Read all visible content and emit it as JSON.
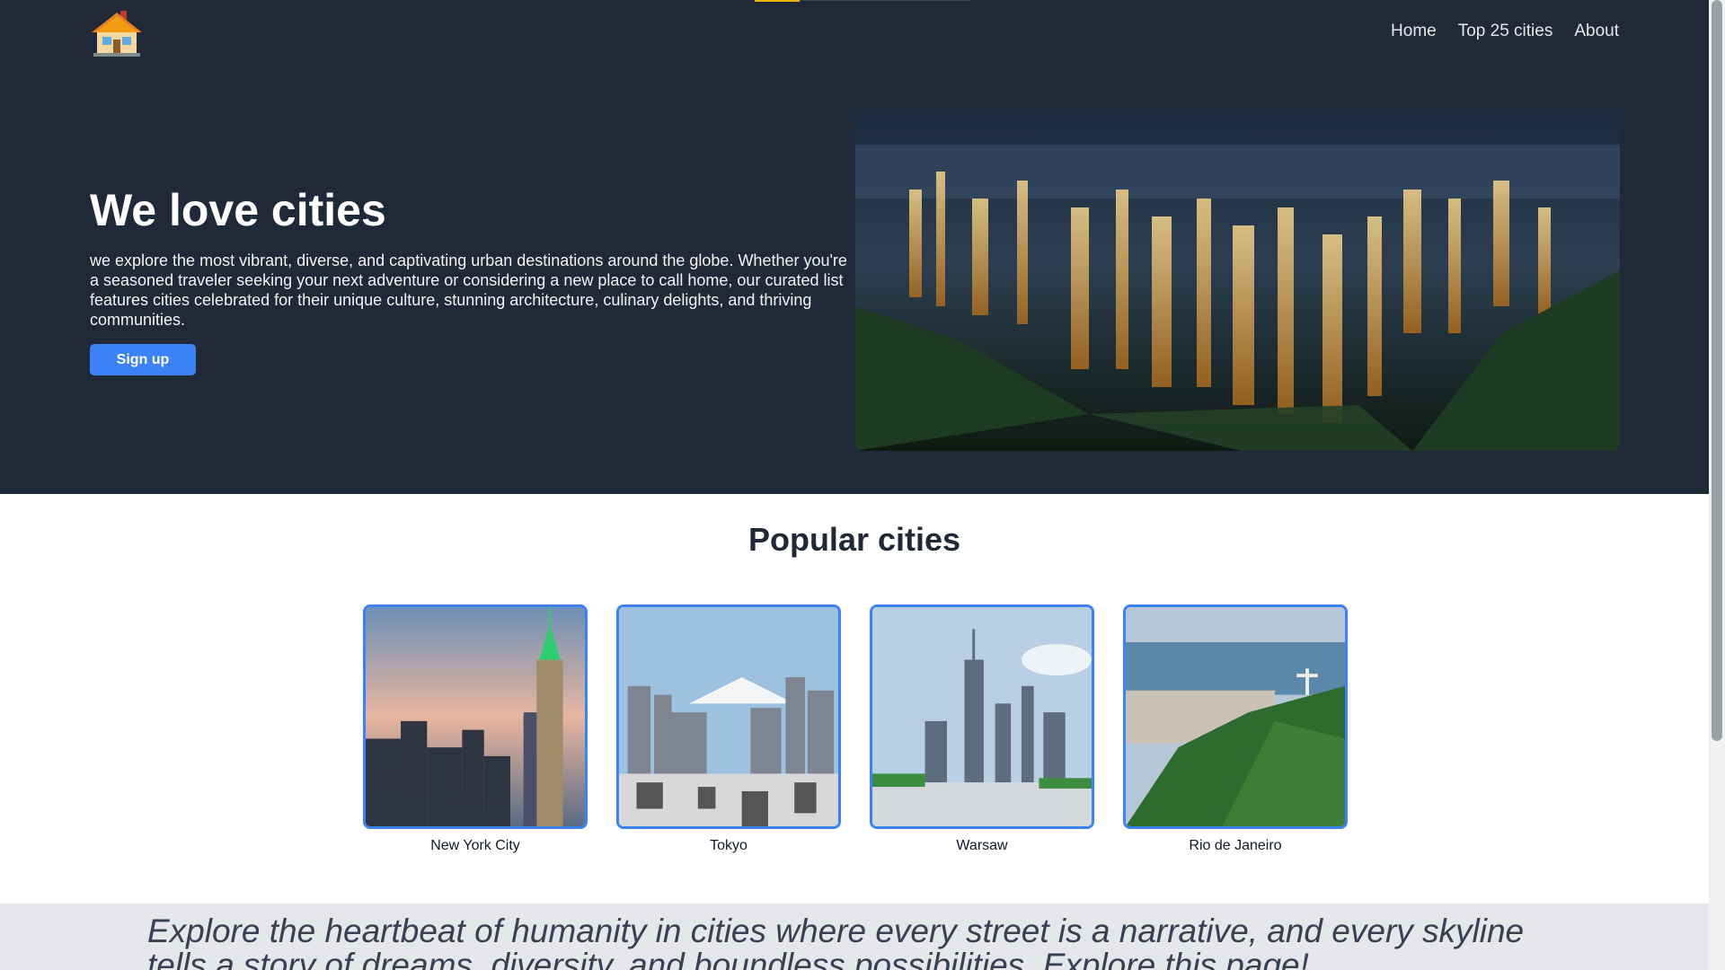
{
  "header": {
    "logo_alt": "house",
    "nav": [
      "Home",
      "Top 25 cities",
      "About"
    ]
  },
  "hero": {
    "title": "We love cities",
    "text": "we explore the most vibrant, diverse, and captivating urban destinations around the globe. Whether you're a seasoned traveler seeking your next adventure or considering a new place to call home, our curated list features cities celebrated for their unique culture, stunning architecture, culinary delights, and thriving communities.",
    "signup_label": "Sign up"
  },
  "popular": {
    "title": "Popular cities",
    "cities": [
      "New York City",
      "Tokyo",
      "Warsaw",
      "Rio de Janeiro"
    ]
  },
  "quote": "Explore the heartbeat of humanity in cities where every street is a narrative, and every skyline tells a story of dreams, diversity, and boundless possibilities. Explore this page!",
  "colors": {
    "header_bg": "#1f2937",
    "accent": "#3b82f6",
    "quote_bg": "#e5e7eb"
  }
}
